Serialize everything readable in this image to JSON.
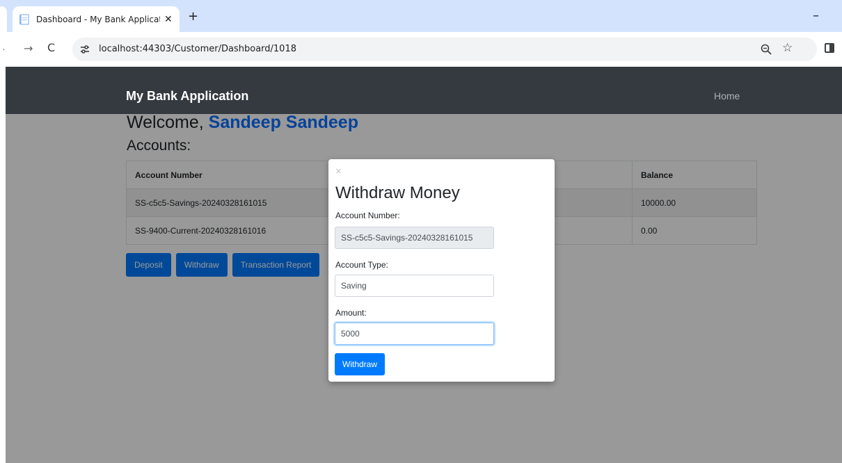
{
  "browser": {
    "tab_title": "Dashboard - My Bank Applicati",
    "tab_close": "✕",
    "new_tab": "+",
    "minimize": "–",
    "url": "localhost:44303/Customer/Dashboard/1018",
    "forward": "→",
    "reload": "C",
    "star": "☆",
    "nav_dot": "·"
  },
  "navbar": {
    "brand": "My Bank Application",
    "home": "Home"
  },
  "dashboard": {
    "welcome_prefix": "Welcome, ",
    "user_name": "Sandeep Sandeep",
    "accounts_heading": "Accounts:",
    "table": {
      "headers": [
        "Account Number",
        "",
        "Balance"
      ],
      "rows": [
        {
          "account_number": "SS-c5c5-Savings-20240328161015",
          "middle": "",
          "balance": "10000.00"
        },
        {
          "account_number": "SS-9400-Current-20240328161016",
          "middle": "",
          "balance": "0.00"
        }
      ]
    },
    "buttons": {
      "deposit": "Deposit",
      "withdraw": "Withdraw",
      "transaction_report": "Transaction Report"
    }
  },
  "modal": {
    "close": "×",
    "title": "Withdraw Money",
    "account_number_label": "Account Number:",
    "account_number_value": "SS-c5c5-Savings-20240328161015",
    "account_type_label": "Account Type:",
    "account_type_value": "Saving",
    "amount_label": "Amount:",
    "amount_value": "5000",
    "submit": "Withdraw"
  },
  "colors": {
    "navbar": "#343a40",
    "primary": "#007bff",
    "tabstrip": "#d3e3fd"
  }
}
